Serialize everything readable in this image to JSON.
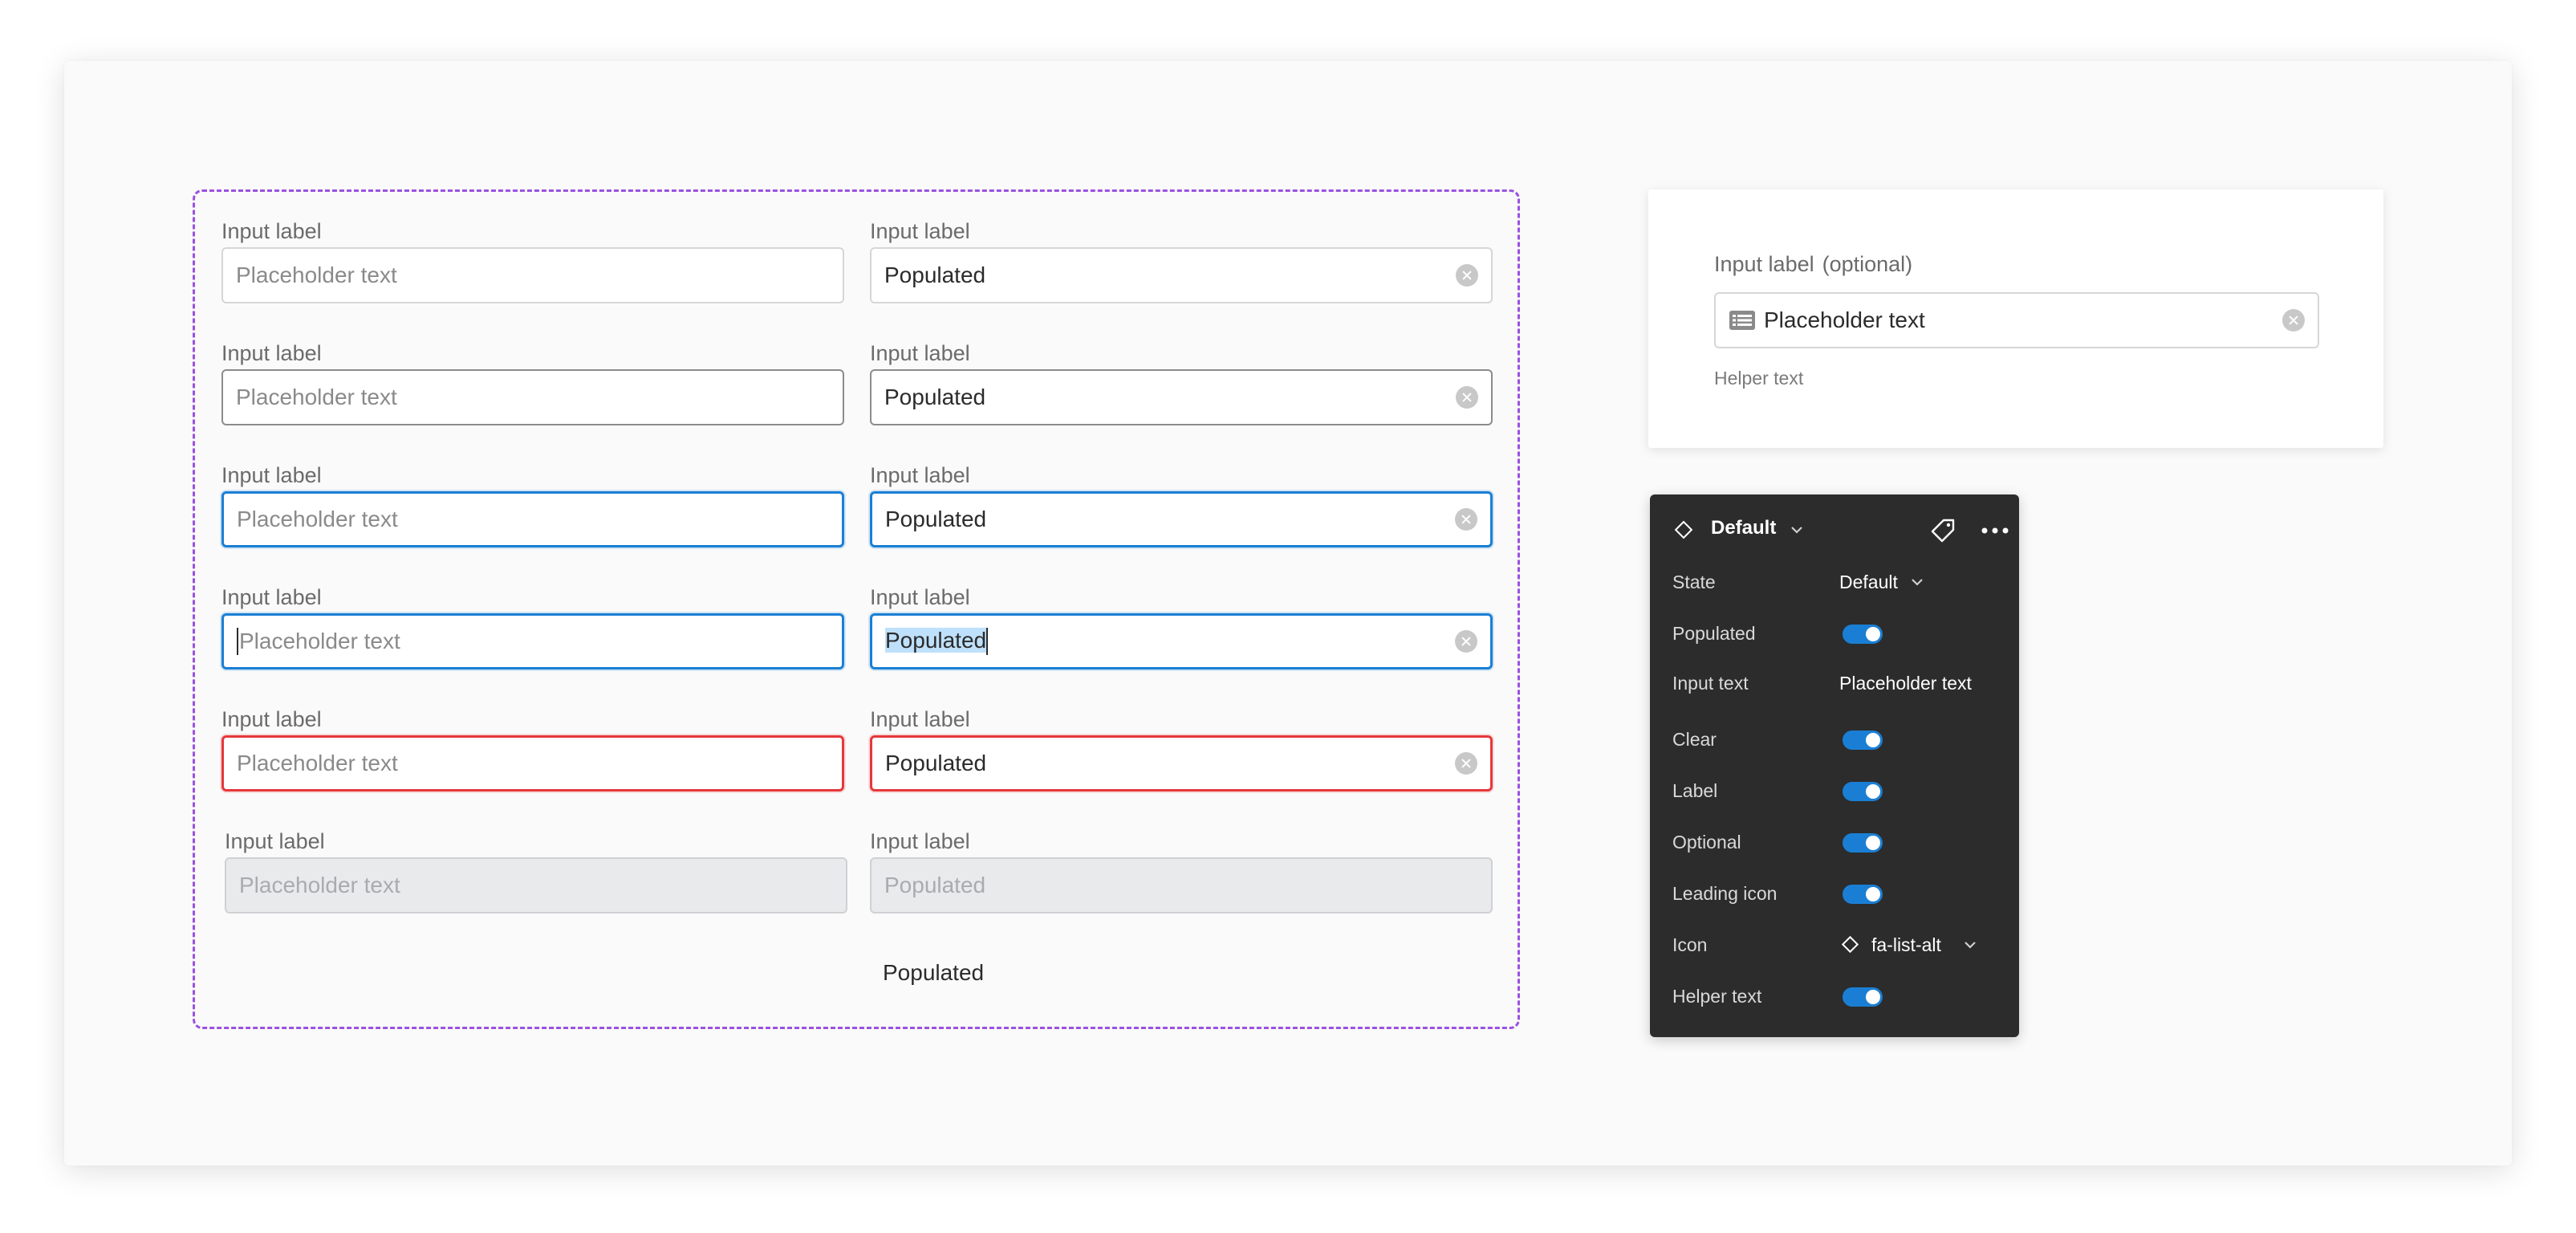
{
  "variants": {
    "label": "Input label",
    "placeholder": "Placeholder text",
    "populated": "Populated",
    "bare_populated": "Populated"
  },
  "preview": {
    "label": "Input label",
    "optional": "(optional)",
    "placeholder": "Placeholder text",
    "helper": "Helper text",
    "leading_icon": "list-alt-icon"
  },
  "panel": {
    "title": "Default",
    "icons": [
      "component-diamond-icon",
      "tag-icon",
      "more-icon"
    ],
    "properties": [
      {
        "label": "State",
        "type": "select",
        "value": "Default"
      },
      {
        "label": "Populated",
        "type": "toggle",
        "on": true
      },
      {
        "label": "Input text",
        "type": "text",
        "value": "Placeholder text"
      },
      {
        "label": "Clear",
        "type": "toggle",
        "on": true
      },
      {
        "label": "Label",
        "type": "toggle",
        "on": true
      },
      {
        "label": "Optional",
        "type": "toggle",
        "on": true
      },
      {
        "label": "Leading icon",
        "type": "toggle",
        "on": true
      },
      {
        "label": "Icon",
        "type": "select",
        "value": "fa-list-alt"
      },
      {
        "label": "Helper text",
        "type": "toggle",
        "on": true
      }
    ]
  },
  "colors": {
    "focus": "#1a7fd4",
    "error": "#e5383b",
    "variant_frame": "#9b51e0",
    "panel_bg": "#2c2c2c"
  }
}
